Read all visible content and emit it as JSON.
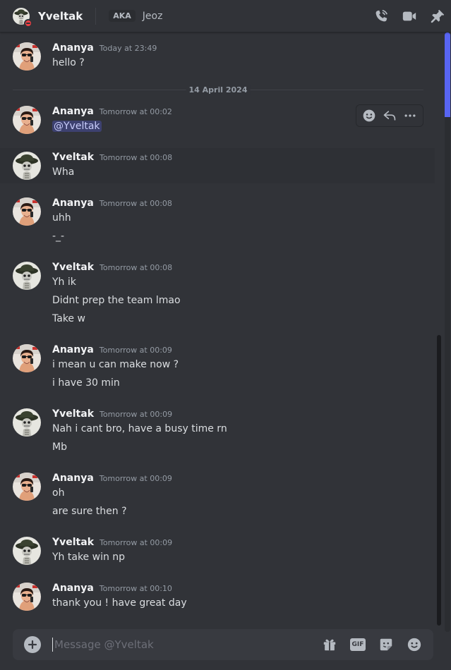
{
  "header": {
    "name": "Yveltak",
    "aka_label": "AKA",
    "aka_name": "Jeoz"
  },
  "icons": {
    "call": "phone-call-icon",
    "video": "video-camera-icon",
    "pin": "pin-icon",
    "add": "plus-circle-icon",
    "gift": "gift-icon",
    "gif": "gif-icon",
    "sticker": "sticker-icon",
    "emoji": "emoji-icon",
    "react": "add-reaction-icon",
    "reply": "reply-icon",
    "more": "more-options-icon"
  },
  "colors": {
    "accent": "#5865f2",
    "dnd_status": "#f23f43",
    "background": "#313338"
  },
  "date_divider": "14 April 2024",
  "messages": [
    {
      "author": "Ananya",
      "timestamp": "Today at 23:49",
      "lines": [
        "hello ?"
      ]
    },
    {
      "author": "Ananya",
      "timestamp": "Tomorrow at 00:02",
      "mention": "@Yveltak"
    },
    {
      "author": "Yveltak",
      "timestamp": "Tomorrow at 00:08",
      "lines": [
        "Wha"
      ]
    },
    {
      "author": "Ananya",
      "timestamp": "Tomorrow at 00:08",
      "lines": [
        "uhh",
        "-_-"
      ]
    },
    {
      "author": "Yveltak",
      "timestamp": "Tomorrow at 00:08",
      "lines": [
        "Yh ik",
        "Didnt prep the team lmao",
        "Take w"
      ]
    },
    {
      "author": "Ananya",
      "timestamp": "Tomorrow at 00:09",
      "lines": [
        "i mean u can make now ?",
        "i have 30 min"
      ]
    },
    {
      "author": "Yveltak",
      "timestamp": "Tomorrow at 00:09",
      "lines": [
        "Nah i cant bro, have a busy time rn",
        "Mb"
      ]
    },
    {
      "author": "Ananya",
      "timestamp": "Tomorrow at 00:09",
      "lines": [
        "oh",
        "are sure then ?"
      ]
    },
    {
      "author": "Yveltak",
      "timestamp": "Tomorrow at 00:09",
      "lines": [
        "Yh take win np"
      ]
    },
    {
      "author": "Ananya",
      "timestamp": "Tomorrow at 00:10",
      "lines": [
        "thank you ! have great day"
      ]
    }
  ],
  "composer": {
    "placeholder": "Message @Yveltak",
    "gif_label": "GIF"
  }
}
